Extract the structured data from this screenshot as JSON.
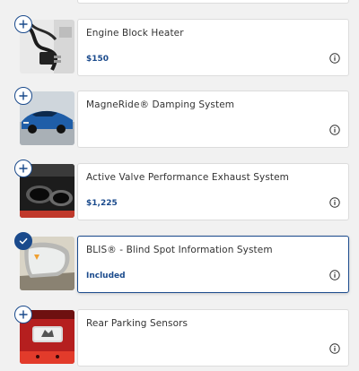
{
  "brand_color": "#1a4a8c",
  "items": [
    {
      "name": "Engine Block Heater",
      "price": "$150",
      "state": "add",
      "thumb_icon": "engine-block-heater-cable-image"
    },
    {
      "name": "MagneRide® Damping System",
      "price": "",
      "state": "add",
      "thumb_icon": "blue-mustang-car-image"
    },
    {
      "name": "Active Valve Performance Exhaust System",
      "price": "$1,225",
      "state": "add",
      "thumb_icon": "exhaust-tips-image"
    },
    {
      "name": "BLIS® - Blind Spot Information System",
      "price": "Included",
      "state": "selected",
      "thumb_icon": "side-mirror-image"
    },
    {
      "name": "Rear Parking Sensors",
      "price": "",
      "state": "add",
      "thumb_icon": "rear-parking-sensors-image"
    }
  ]
}
